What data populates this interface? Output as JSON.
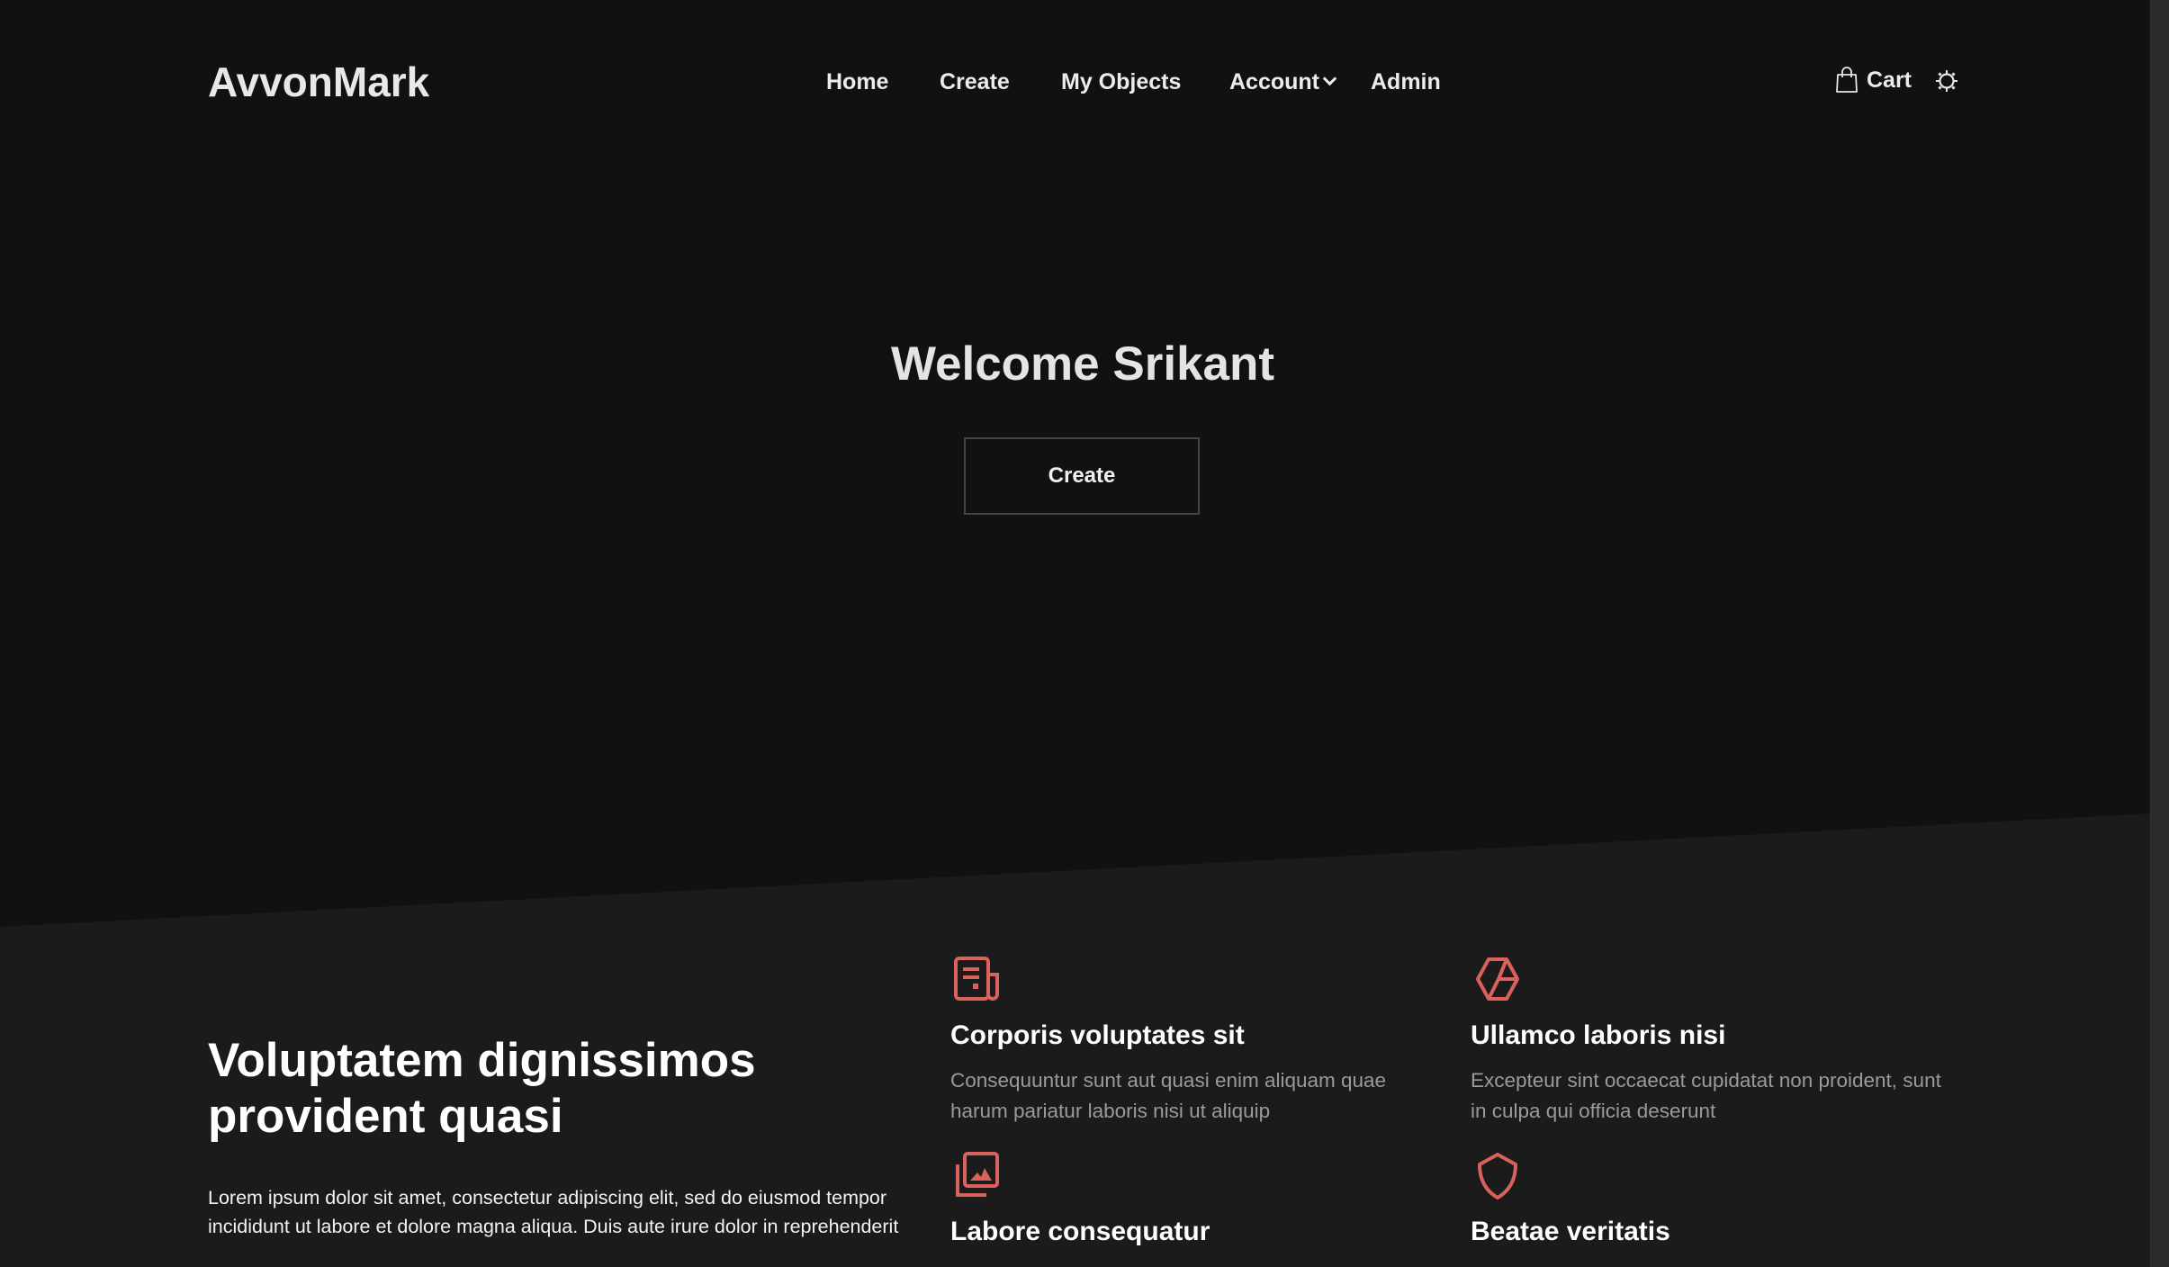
{
  "header": {
    "logo": "AvvonMark",
    "nav": [
      {
        "label": "Home"
      },
      {
        "label": "Create"
      },
      {
        "label": "My Objects"
      },
      {
        "label": "Account"
      },
      {
        "label": "Admin"
      }
    ],
    "cart_label": "Cart",
    "cart_icon": "shopping-bag-icon",
    "theme_icon": "sun-icon"
  },
  "hero": {
    "title": "Welcome Srikant",
    "button_label": "Create"
  },
  "features": {
    "heading_lines": [
      "Voluptatem dignissimos",
      "provident quasi"
    ],
    "paragraph_lines": [
      "Lorem ipsum dolor sit amet, consectetur adipiscing elit, sed do eiusmod tempor",
      "incididunt ut labore et dolore magna aliqua. Duis aute irure dolor in reprehenderit"
    ],
    "accent_color": "#d9625d",
    "items": [
      {
        "icon": "newspaper-icon",
        "title": "Corporis voluptates sit",
        "desc_lines": [
          "Consequuntur sunt aut quasi enim aliquam quae",
          "harum pariatur laboris nisi ut aliquip"
        ]
      },
      {
        "icon": "cube-icon",
        "title": "Ullamco laboris nisi",
        "desc_lines": [
          "Excepteur sint occaecat cupidatat non proident, sunt",
          "in culpa qui officia deserunt"
        ]
      },
      {
        "icon": "images-icon",
        "title": "Labore consequatur"
      },
      {
        "icon": "shield-icon",
        "title": "Beatae veritatis"
      }
    ]
  }
}
